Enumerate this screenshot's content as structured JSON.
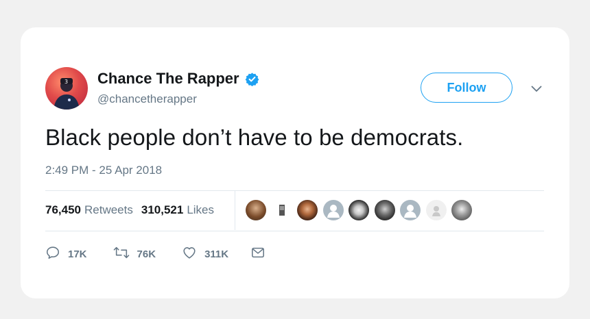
{
  "tweet": {
    "author_name": "Chance The Rapper",
    "handle": "@chancetherapper",
    "verified": true,
    "follow_label": "Follow",
    "text": "Black people don’t have to be democrats.",
    "timestamp": "2:49 PM - 25 Apr 2018",
    "stats": {
      "retweets_count": "76,450",
      "retweets_label": "Retweets",
      "likes_count": "310,521",
      "likes_label": "Likes"
    },
    "actions": {
      "reply_count": "17K",
      "retweet_count": "76K",
      "like_count": "311K"
    }
  },
  "colors": {
    "accent": "#1da1f2",
    "secondary_text": "#657786",
    "divider": "#e1e8ed",
    "background": "#f1f1f1"
  },
  "icons": [
    "verified-badge-icon",
    "chevron-down-icon",
    "reply-icon",
    "retweet-icon",
    "like-icon",
    "direct-message-icon"
  ]
}
